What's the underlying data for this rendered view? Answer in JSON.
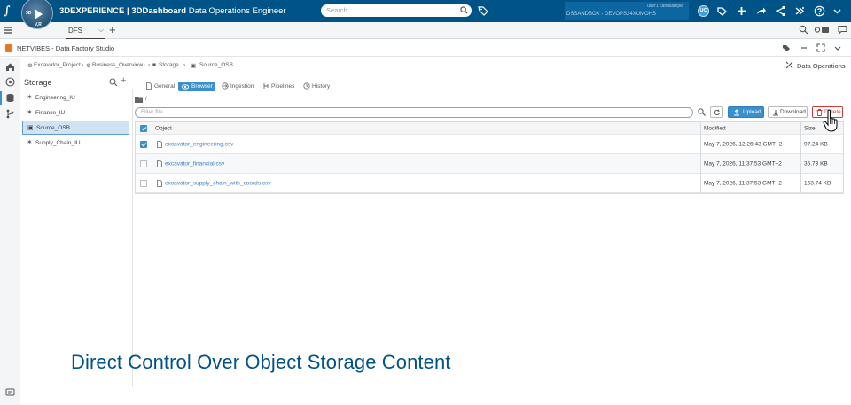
{
  "topbar": {
    "brand_bold": "3DEXPERIENCE | 3DDashboard",
    "brand_role": "Data Operations Engineer",
    "search_placeholder": "Search",
    "user_line1": "user1 candsample",
    "user_line2": "DSSANDBOX - DEVOPS24XUMOHS",
    "avatar_initials": "UC",
    "compass_letters": "3D",
    "compass_sub": "V,R"
  },
  "tabbar": {
    "dashboard_tab": "DFS"
  },
  "widget": {
    "title": "NETVIBES - Data Factory Studio"
  },
  "breadcrumb": {
    "items": [
      "Excavator_Project",
      "Business_Overview",
      "Storage",
      "Source_OSB"
    ],
    "right_label": "Data Operations"
  },
  "storage": {
    "title": "Storage",
    "items": [
      {
        "label": "Engineering_IU",
        "active": false
      },
      {
        "label": "Finance_IU",
        "active": false
      },
      {
        "label": "Source_OSB",
        "active": true
      },
      {
        "label": "Supply_Chain_IU",
        "active": false
      }
    ]
  },
  "subtabs": [
    {
      "label": "General",
      "active": false
    },
    {
      "label": "Browser",
      "active": true
    },
    {
      "label": "Ingestion",
      "active": false
    },
    {
      "label": "Pipelines",
      "active": false
    },
    {
      "label": "History",
      "active": false
    }
  ],
  "browser": {
    "path": "/",
    "filter_placeholder": "Filter file",
    "upload_label": "Upload",
    "download_label": "Download",
    "delete_label": "Delete"
  },
  "table": {
    "headers": {
      "object": "Object",
      "modified": "Modified",
      "size": "Size"
    },
    "rows": [
      {
        "name": "excavator_engineering.csv",
        "modified": "May 7, 2026, 12:26:43 GMT+2",
        "size": "97.24 KB",
        "checked": true
      },
      {
        "name": "excavator_financial.csv",
        "modified": "May 7, 2026, 11:37:53 GMT+2",
        "size": "35.73 KB",
        "checked": false
      },
      {
        "name": "excavator_supply_chain_with_coords.csv",
        "modified": "May 7, 2026, 11:37:53 GMT+2",
        "size": "153.74 KB",
        "checked": false
      }
    ]
  },
  "caption": "Direct Control Over Object Storage Content",
  "colors": {
    "topbar": "#005386",
    "accent": "#3a8fce",
    "danger": "#cc3b3b",
    "netvibes": "#e87722"
  }
}
